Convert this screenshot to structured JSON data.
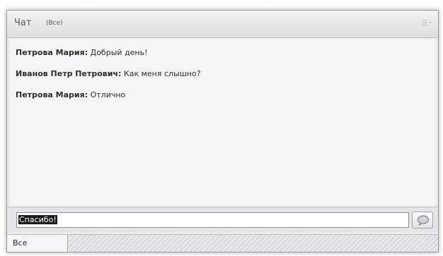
{
  "header": {
    "title": "Чат",
    "filter": "(Все)",
    "menu_icon": "list-menu-icon"
  },
  "messages": [
    {
      "author": "Петрова Мария:",
      "text": "Добрый день!"
    },
    {
      "author": "Иванов Петр Петрович:",
      "text": "Как меня слышно?"
    },
    {
      "author": "Петрова Мария:",
      "text": "Отлично"
    }
  ],
  "input": {
    "value": "Спасибо!",
    "send_icon": "speech-bubble-icon"
  },
  "footer": {
    "tab_label": "Все"
  }
}
